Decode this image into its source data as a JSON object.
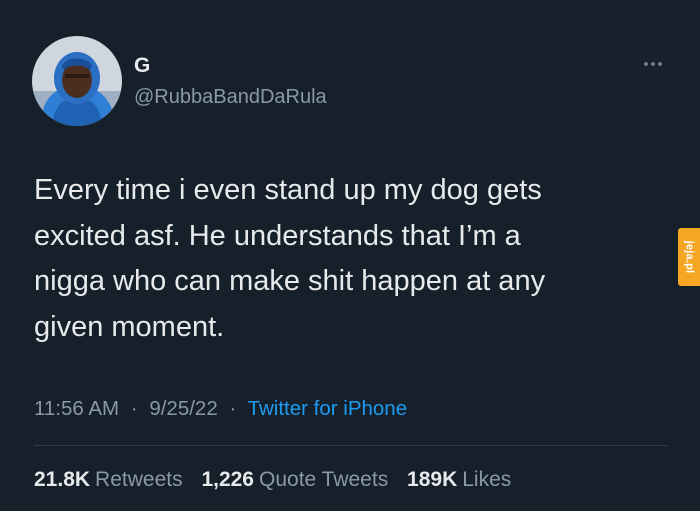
{
  "tweet": {
    "display_name": "G",
    "handle": "@RubbaBandDaRula",
    "text": "Every time i even stand up my dog gets\nexcited asf. He understands that I’m a\nnigga who can make shit happen at any\ngiven moment.",
    "time": "11:56 AM",
    "separator": "·",
    "date": "9/25/22",
    "source": "Twitter for iPhone"
  },
  "stats": {
    "retweets_count": "21.8K",
    "retweets_label": "Retweets",
    "quote_count": "1,226",
    "quote_label": "Quote Tweets",
    "likes_count": "189K",
    "likes_label": "Likes"
  },
  "watermark": {
    "text": "jeja.pl"
  },
  "icons": {
    "more": "more-horizontal-icon"
  },
  "colors": {
    "background": "#15202b",
    "primary_text": "#e7e9ea",
    "secondary_text": "#8b98a5",
    "link": "#1d9bf0",
    "watermark": "#f5a623"
  }
}
